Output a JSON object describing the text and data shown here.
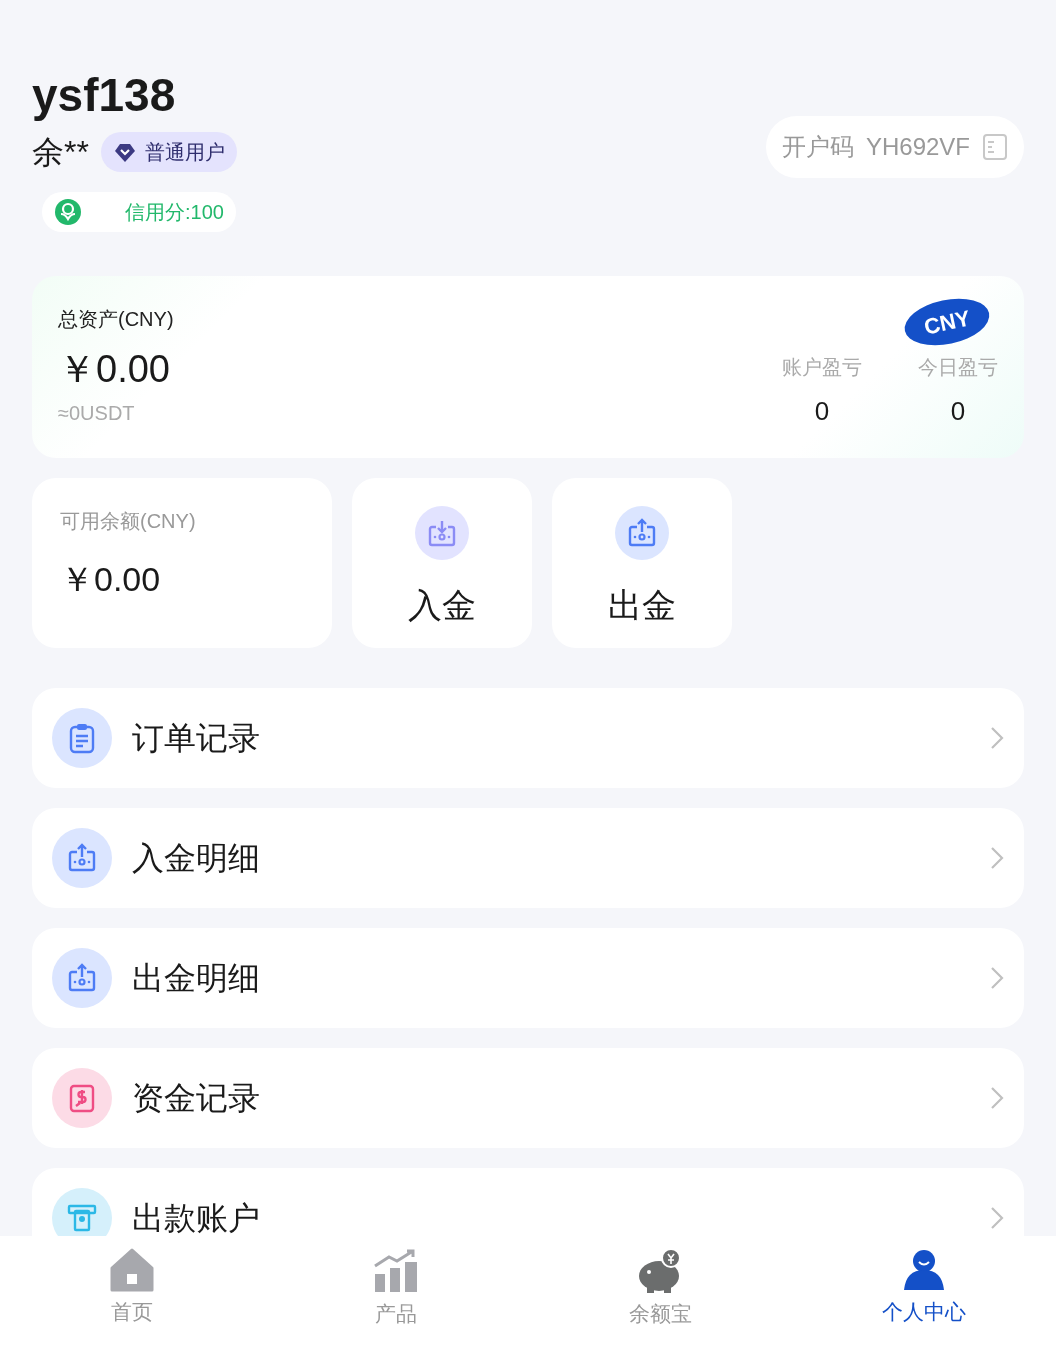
{
  "user": {
    "username": "ysf138",
    "name": "余**",
    "level_badge": "普通用户",
    "credit": "信用分:100",
    "account_code_label": "开户码",
    "account_code": "YH692VF"
  },
  "assets": {
    "title": "总资产(CNY)",
    "amount": "￥0.00",
    "usdt": "≈0USDT",
    "currency_badge": "CNY",
    "stats": [
      {
        "label": "账户盈亏",
        "value": "0"
      },
      {
        "label": "今日盈亏",
        "value": "0"
      }
    ]
  },
  "balance": {
    "title": "可用余额(CNY)",
    "amount": "￥0.00"
  },
  "actions": [
    {
      "kind": "deposit",
      "label": "入金"
    },
    {
      "kind": "withdraw",
      "label": "出金"
    }
  ],
  "menu": [
    {
      "kind": "orders",
      "label": "订单记录"
    },
    {
      "kind": "withdraw",
      "label": "入金明细"
    },
    {
      "kind": "withdraw",
      "label": "出金明细"
    },
    {
      "kind": "funds",
      "label": "资金记录"
    },
    {
      "kind": "atm",
      "label": "出款账户"
    }
  ],
  "tabbar": [
    {
      "kind": "home",
      "label": "首页",
      "selected": false
    },
    {
      "kind": "products",
      "label": "产品",
      "selected": false
    },
    {
      "kind": "savings",
      "label": "余额宝",
      "selected": false
    },
    {
      "kind": "profile",
      "label": "个人中心",
      "selected": true
    }
  ]
}
